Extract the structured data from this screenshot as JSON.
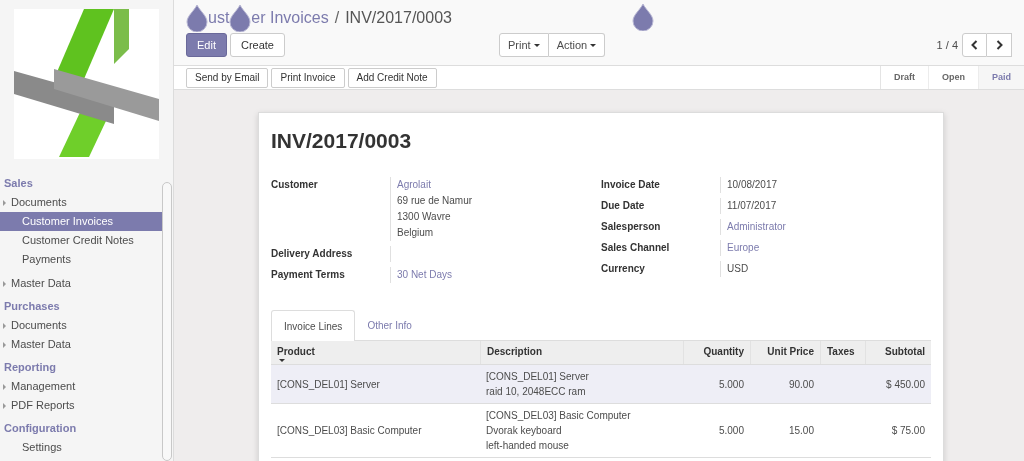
{
  "sidebar": {
    "sections": [
      {
        "title": "Sales",
        "items": [
          {
            "label": "Documents",
            "kind": "folder",
            "children": [
              {
                "label": "Customer Invoices",
                "selected": true
              },
              {
                "label": "Customer Credit Notes",
                "selected": false
              },
              {
                "label": "Payments",
                "selected": false
              }
            ]
          },
          {
            "label": "Master Data",
            "kind": "folder"
          }
        ]
      },
      {
        "title": "Purchases",
        "items": [
          {
            "label": "Documents",
            "kind": "folder"
          },
          {
            "label": "Master Data",
            "kind": "folder"
          }
        ]
      },
      {
        "title": "Reporting",
        "items": [
          {
            "label": "Management",
            "kind": "folder"
          },
          {
            "label": "PDF Reports",
            "kind": "folder"
          }
        ]
      },
      {
        "title": "Configuration",
        "items": [
          {
            "label": "Settings",
            "kind": "leaf"
          }
        ]
      }
    ]
  },
  "breadcrumb": {
    "parent_fragments": [
      "ust",
      "er Invoices"
    ],
    "separator": "/",
    "current": "INV/2017/0003"
  },
  "buttons": [
    {
      "label": "Edit",
      "kind": "primary"
    },
    {
      "label": "Create",
      "kind": "default"
    }
  ],
  "dropdowns": [
    {
      "label": "Print"
    },
    {
      "label": "Action"
    }
  ],
  "pager": {
    "text": "1 / 4"
  },
  "action_buttons": [
    "Send by Email",
    "Print Invoice",
    "Add Credit Note"
  ],
  "status_steps": [
    {
      "label": "Draft",
      "selected": false
    },
    {
      "label": "Open",
      "selected": false
    },
    {
      "label": "Paid",
      "selected": true
    }
  ],
  "sheet": {
    "title": "INV/2017/0003",
    "left_fields": [
      {
        "label": "Customer",
        "lines": [
          {
            "text": "Agrolait",
            "link": true
          },
          {
            "text": "69 rue de Namur",
            "link": false
          },
          {
            "text": "1300 Wavre",
            "link": false
          },
          {
            "text": "Belgium",
            "link": false
          }
        ]
      },
      {
        "label": "Delivery Address"
      },
      {
        "label": "Payment Terms",
        "lines": [
          {
            "text": "30 Net Days",
            "link": true
          }
        ]
      }
    ],
    "right_fields": [
      {
        "label": "Invoice Date",
        "lines": [
          {
            "text": "10/08/2017",
            "link": false
          }
        ]
      },
      {
        "label": "Due Date",
        "lines": [
          {
            "text": "11/07/2017",
            "link": false
          }
        ]
      },
      {
        "label": "Salesperson",
        "lines": [
          {
            "text": "Administrator",
            "link": true
          }
        ]
      },
      {
        "label": "Sales Channel",
        "lines": [
          {
            "text": "Europe",
            "link": true
          }
        ]
      },
      {
        "label": "Currency",
        "lines": [
          {
            "text": "USD",
            "link": false
          }
        ]
      }
    ],
    "tabs": [
      {
        "label": "Invoice Lines",
        "selected": true
      },
      {
        "label": "Other Info",
        "selected": false
      }
    ],
    "table": {
      "columns": [
        {
          "label": "Product",
          "numeric": false,
          "sorted": true
        },
        {
          "label": "Description",
          "numeric": false,
          "sorted": false
        },
        {
          "label": "Quantity",
          "numeric": true,
          "sorted": false
        },
        {
          "label": "Unit Price",
          "numeric": true,
          "sorted": false
        },
        {
          "label": "Taxes",
          "numeric": false,
          "sorted": false
        },
        {
          "label": "Subtotal",
          "numeric": true,
          "sorted": false
        }
      ],
      "rows": [
        {
          "selected": true,
          "cells": [
            [
              "[CONS_DEL01] Server"
            ],
            [
              "[CONS_DEL01] Server",
              "raid 10, 2048ECC ram"
            ],
            [
              "5.000"
            ],
            [
              "90.00"
            ],
            [],
            [
              "$ 450.00"
            ]
          ]
        },
        {
          "selected": false,
          "cells": [
            [
              "[CONS_DEL03] Basic Computer"
            ],
            [
              "[CONS_DEL03] Basic Computer",
              "Dvorak keyboard",
              "left-handed mouse"
            ],
            [
              "5.000"
            ],
            [
              "15.00"
            ],
            [],
            [
              "$ 75.00"
            ]
          ]
        }
      ]
    }
  }
}
